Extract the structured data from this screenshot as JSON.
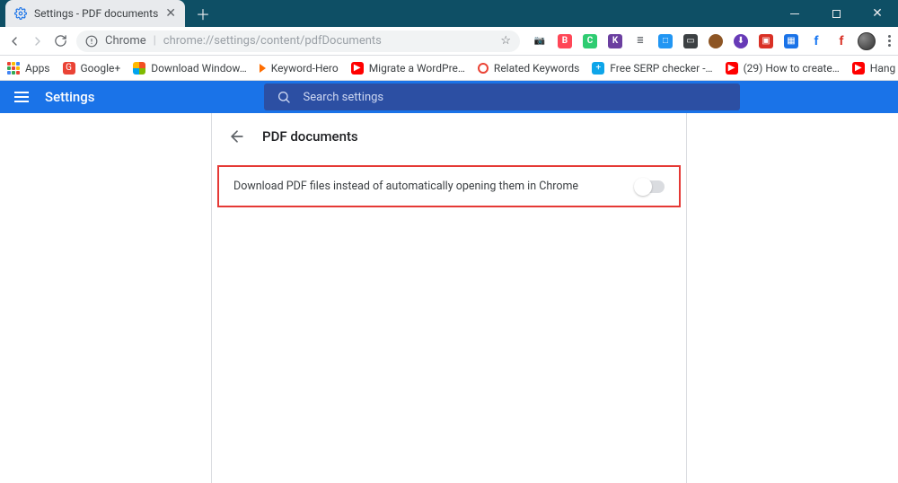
{
  "window": {
    "min_label": "Minimize",
    "max_label": "Maximize",
    "close_label": "Close"
  },
  "tab": {
    "title": "Settings - PDF documents"
  },
  "toolbar": {
    "address_label": "Chrome",
    "url_rest": "chrome://settings/content/pdfDocuments"
  },
  "bookmarks": {
    "apps": "Apps",
    "items": [
      {
        "label": "Google+",
        "color": "#ea4335",
        "glyph": "G"
      },
      {
        "label": "Download Window…",
        "color_multi": true
      },
      {
        "label": "Keyword-Hero",
        "color": "#ff6d00",
        "glyph": "▶",
        "triangle": true
      },
      {
        "label": "Migrate a WordPre…",
        "color": "#ff0000",
        "glyph": "▶"
      },
      {
        "label": "Related Keywords",
        "color": "#ffffff",
        "ring": "#ea4335"
      },
      {
        "label": "Free SERP checker -…",
        "color": "#0ea5e9",
        "glyph": "+"
      },
      {
        "label": "(29) How to create…",
        "color": "#ff0000",
        "glyph": "▶"
      },
      {
        "label": "Hang Ups (Want Yo…",
        "color": "#ff0000",
        "glyph": "▶"
      }
    ]
  },
  "extensions": {
    "items": [
      {
        "name": "camera-icon",
        "color": "#5f6368",
        "glyph": "📷"
      },
      {
        "name": "ext-b",
        "color": "#ff4757",
        "glyph": "B"
      },
      {
        "name": "ext-c",
        "color": "#2ecc71",
        "glyph": "C"
      },
      {
        "name": "ext-k",
        "color": "#6b3fa0",
        "glyph": "K"
      },
      {
        "name": "ext-lines",
        "color": "#9aa0a6",
        "glyph": "≣"
      },
      {
        "name": "ext-folder",
        "color": "#2196f3",
        "glyph": "□"
      },
      {
        "name": "ext-screen",
        "color": "#3c4043",
        "glyph": "▭"
      },
      {
        "name": "ext-cookie",
        "color": "#8d5524",
        "glyph": "●"
      },
      {
        "name": "ext-down",
        "color": "#673ab7",
        "glyph": "⬇"
      },
      {
        "name": "ext-pdf",
        "color": "#d93025",
        "glyph": "▣"
      },
      {
        "name": "ext-cal",
        "color": "#1a73e8",
        "glyph": "▦"
      },
      {
        "name": "ext-f1",
        "color": "#1877f2",
        "glyph": "f"
      },
      {
        "name": "ext-f2",
        "color": "#d93025",
        "glyph": "f"
      }
    ]
  },
  "settings": {
    "title": "Settings",
    "search_placeholder": "Search settings",
    "page_title": "PDF documents",
    "pdf_toggle_label": "Download PDF files instead of automatically opening them in Chrome",
    "pdf_toggle_on": false
  }
}
